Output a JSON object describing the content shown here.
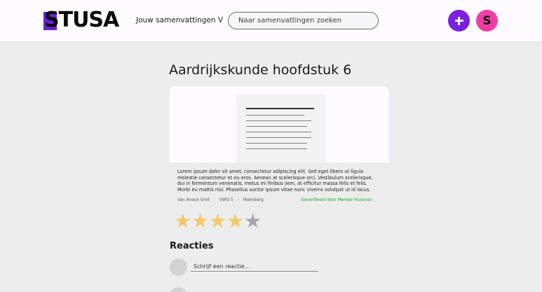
{
  "header": {
    "logo_text": "STUSA",
    "nav_link": "Jouw samenvattingen V",
    "search_placeholder": "Naar samenvattingen zoeken",
    "avatar_letter": "S",
    "accent_purple": "#7b1fe0",
    "avatar_pink": "#f03ca7"
  },
  "main": {
    "title": "Aardrijkskunde hoofdstuk 6",
    "card": {
      "description": "Lorem ipsum dolor sit amet, consectetur adipiscing elit. Sed eget libero ut ligula molestie consectetur et eu eros. Aenean at scelerisque orci. Vestibulum scelerisque, dui in fermentum venenatis, metus mi finibus sem, at efficitur massa felis et felis. Morbi eu mattis nisl. Phasellus auctor ipsum vitae nunc viverra volutpat ut id lacus.",
      "author": "Van Anouk Smit",
      "level": "VWO 5",
      "publisher": "Malmberg",
      "separator": "-",
      "verified": "Geverifieerd door Meneer Huisman",
      "verified_color": "#1ea62f"
    },
    "rating": {
      "value": 4,
      "max": 5,
      "star_glyph": "★"
    },
    "comments": {
      "title": "Reacties",
      "input_placeholder": "Schrijf een reactie..."
    }
  }
}
